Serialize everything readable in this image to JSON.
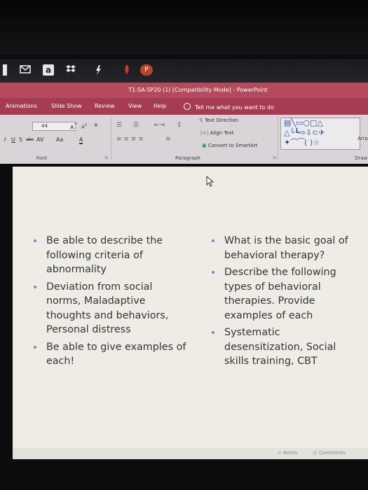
{
  "window": {
    "title": "T1-SA-SP20 (1) [Compatibility Mode] - PowerPoint"
  },
  "taskbar": {
    "icons": [
      "mail-icon",
      "amazon-icon",
      "dropbox-icon",
      "sync-icon",
      "pdf-icon",
      "powerpoint-icon"
    ],
    "amazon_glyph": "a",
    "ppt_glyph": "P"
  },
  "ribbon": {
    "tabs": [
      "Animations",
      "Slide Show",
      "Review",
      "View",
      "Help"
    ],
    "tell_me": "Tell me what you want to do",
    "font": {
      "size": "44",
      "group_label": "Font",
      "change_case": "Aa",
      "font_color": "A"
    },
    "paragraph": {
      "text_direction": "Text Direction",
      "align_text": "Align Text",
      "convert_smartart": "Convert to SmartArt",
      "group_label": "Paragraph"
    },
    "drawing": {
      "arrange": "Arra",
      "group_label": "Draw"
    }
  },
  "slide": {
    "left_bullets": [
      "Be able to describe the following criteria of abnormality",
      "Deviation from social norms, Maladaptive thoughts and behaviors, Personal distress",
      "Be able to give examples of each!"
    ],
    "right_bullets": [
      "What is the basic goal of behavioral therapy?",
      "Describe the following types of behavioral therapies.  Provide examples of each",
      "Systematic desensitization, Social skills training, CBT"
    ]
  },
  "statusbar": {
    "notes": "Notes",
    "comments": "Comments"
  },
  "colors": {
    "title_bar": "#b34a5e",
    "tabs_bar": "#a63c54",
    "ribbon_bg": "#d8d4d7",
    "slide_bg": "#eeece4",
    "bullet_text": "#34343c",
    "bullet_dot": "#6f8fc2"
  }
}
